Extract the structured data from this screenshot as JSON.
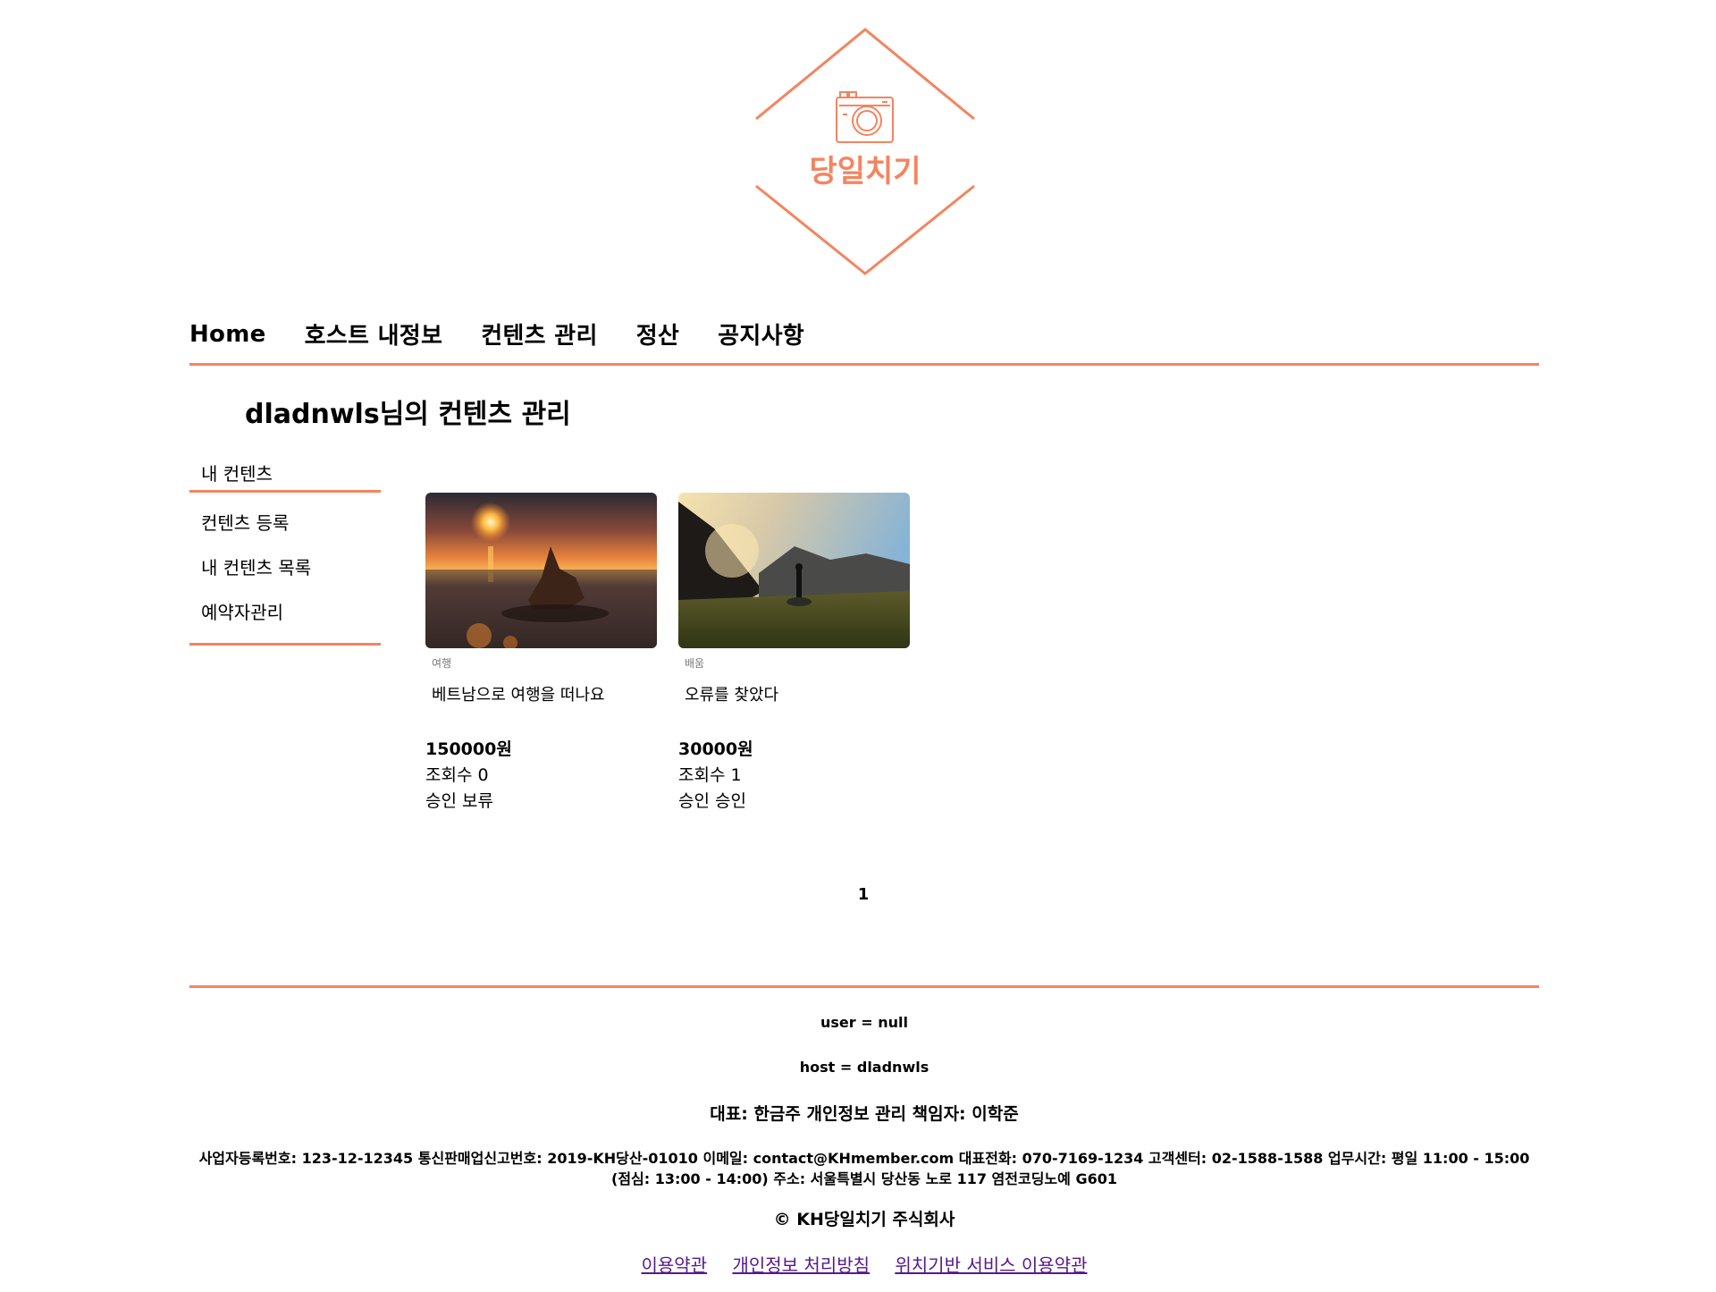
{
  "logo": {
    "text": "당일치기",
    "color": "#f4845f"
  },
  "nav": {
    "items": [
      "Home",
      "호스트 내정보",
      "컨텐츠 관리",
      "정산",
      "공지사항"
    ]
  },
  "page": {
    "title": "dladnwls님의 컨텐츠 관리"
  },
  "sidebar": {
    "heading": "내 컨텐츠",
    "items": [
      "컨텐츠 등록",
      "내 컨텐츠 목록",
      "예약자관리"
    ]
  },
  "cards": [
    {
      "category": "여행",
      "title": "베트남으로 여행을 떠나요",
      "price": "150000원",
      "views": "조회수 0",
      "status_label": "승인 ",
      "status": "보류"
    },
    {
      "category": "배움",
      "title": "오류를 찾았다",
      "price": "30000원",
      "views": "조회수 1",
      "status_label": "승인 ",
      "status": "승인"
    }
  ],
  "pagination": {
    "current": "1"
  },
  "footer": {
    "user": "user = null",
    "host": "host = dladnwls",
    "representative": "대표: 한금주 개인정보 관리 책임자: 이학준",
    "business_info": "사업자등록번호: 123-12-12345 통신판매업신고번호: 2019-KH당산-01010 이메일: contact@KHmember.com 대표전화: 070-7169-1234 고객센터: 02-1588-1588 업무시간: 평일 11:00 - 15:00 (점심: 13:00 - 14:00) 주소: 서울특별시 당산동 노로 117 염전코딩노예 G601",
    "copyright": "© KH당일치기 주식회사",
    "links": [
      "이용약관",
      "개인정보 처리방침",
      "위치기반 서비스 이용약관"
    ]
  },
  "colors": {
    "accent": "#f4845f",
    "link": "#551a8b"
  }
}
